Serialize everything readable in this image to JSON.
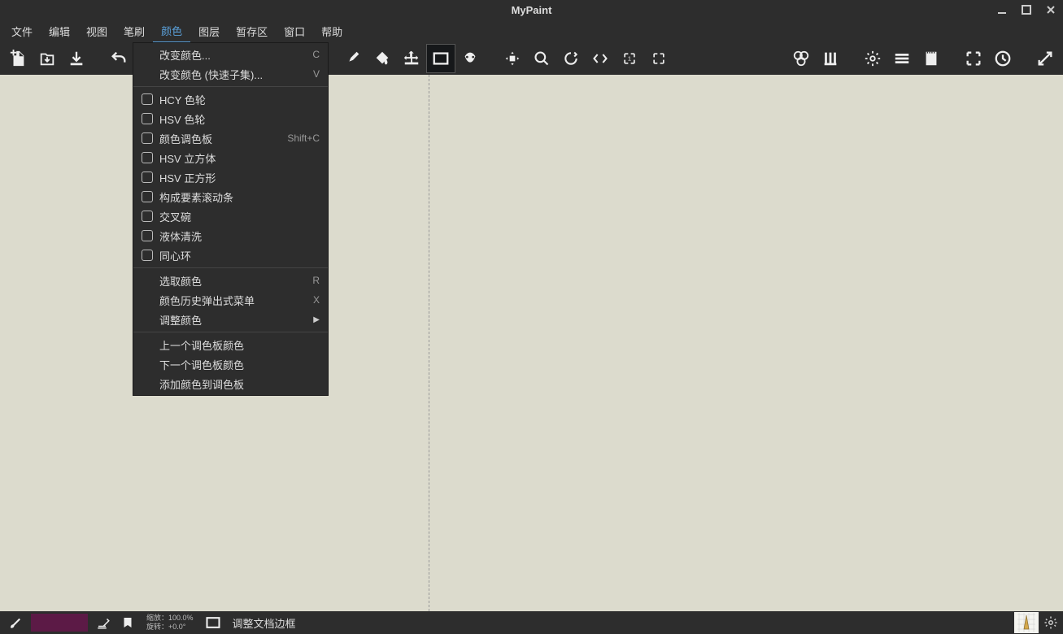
{
  "window": {
    "title": "MyPaint"
  },
  "menubar": {
    "items": [
      "文件",
      "编辑",
      "视图",
      "笔刷",
      "颜色",
      "图层",
      "暂存区",
      "窗口",
      "帮助"
    ],
    "active_index": 4
  },
  "dropdown": {
    "sections": [
      {
        "type": "item",
        "label": "改变颜色...",
        "shortcut": "C"
      },
      {
        "type": "item",
        "label": "改变颜色 (快速子集)...",
        "shortcut": "V"
      },
      {
        "type": "sep"
      },
      {
        "type": "check",
        "label": "HCY 色轮"
      },
      {
        "type": "check",
        "label": "HSV 色轮"
      },
      {
        "type": "check",
        "label": "颜色调色板",
        "shortcut": "Shift+C"
      },
      {
        "type": "check",
        "label": "HSV 立方体"
      },
      {
        "type": "check",
        "label": "HSV 正方形"
      },
      {
        "type": "check",
        "label": "构成要素滚动条"
      },
      {
        "type": "check",
        "label": "交叉碗"
      },
      {
        "type": "check",
        "label": "液体清洗"
      },
      {
        "type": "check",
        "label": "同心环"
      },
      {
        "type": "sep"
      },
      {
        "type": "item",
        "label": "选取颜色",
        "shortcut": "R"
      },
      {
        "type": "item",
        "label": "颜色历史弹出式菜单",
        "shortcut": "X"
      },
      {
        "type": "item",
        "label": "调整颜色",
        "submenu": true
      },
      {
        "type": "sep"
      },
      {
        "type": "item",
        "label": "上一个调色板颜色"
      },
      {
        "type": "item",
        "label": "下一个调色板颜色"
      },
      {
        "type": "item",
        "label": "添加颜色到调色板"
      }
    ]
  },
  "statusbar": {
    "zoom_label": "缩放：",
    "zoom_value": "100.0%",
    "rotation_label": "旋转：",
    "rotation_value": "+0.0°",
    "mode_text": "调整文档边框"
  },
  "colors": {
    "current_swatch": "#5c1a46",
    "canvas_bg": "#dcdbcd"
  }
}
